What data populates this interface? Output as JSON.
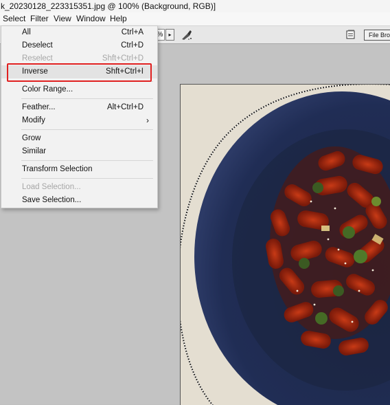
{
  "window": {
    "title": "k_20230128_223315351.jpg @ 100% (Background, RGB)]"
  },
  "menubar": {
    "items": [
      "Select",
      "Filter",
      "View",
      "Window",
      "Help"
    ]
  },
  "toolbar": {
    "zoom_suffix": "%",
    "zoom_arrow": "▸",
    "file_browser_label": "File Browser"
  },
  "select_menu": {
    "items": [
      {
        "label": "All",
        "shortcut": "Ctrl+A",
        "enabled": true
      },
      {
        "label": "Deselect",
        "shortcut": "Ctrl+D",
        "enabled": true
      },
      {
        "label": "Reselect",
        "shortcut": "Shft+Ctrl+D",
        "enabled": false
      },
      {
        "label": "Inverse",
        "shortcut": "Shft+Ctrl+I",
        "enabled": true,
        "highlighted": true
      },
      {
        "label": "Color Range...",
        "shortcut": "",
        "enabled": true
      },
      {
        "label": "Feather...",
        "shortcut": "Alt+Ctrl+D",
        "enabled": true
      },
      {
        "label": "Modify",
        "shortcut": "",
        "enabled": true,
        "submenu_arrow": "›"
      },
      {
        "label": "Grow",
        "shortcut": "",
        "enabled": true
      },
      {
        "label": "Similar",
        "shortcut": "",
        "enabled": true
      },
      {
        "label": "Transform Selection",
        "shortcut": "",
        "enabled": true
      },
      {
        "label": "Load Selection...",
        "shortcut": "",
        "enabled": false
      },
      {
        "label": "Save Selection...",
        "shortcut": "",
        "enabled": true
      }
    ]
  },
  "colors": {
    "highlight_border": "#e02020",
    "plate": "#1d2a4d",
    "background": "#c3c3c3"
  }
}
